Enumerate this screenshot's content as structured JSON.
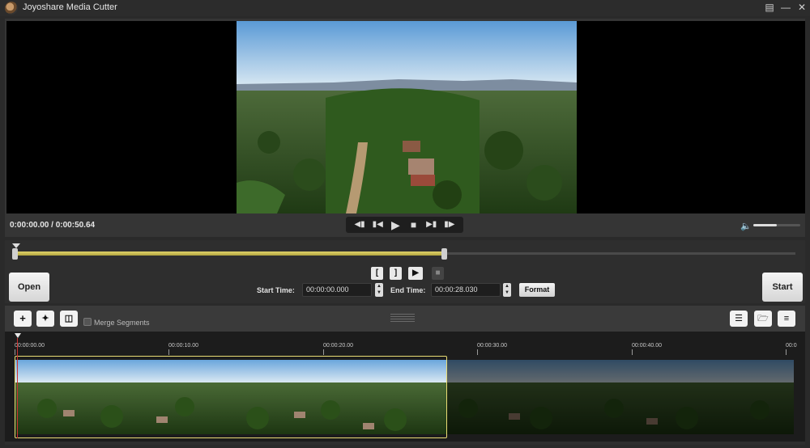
{
  "app": {
    "title": "Joyoshare Media Cutter"
  },
  "player": {
    "current_time": "0:00:00.00",
    "total_time": "0:00:50.64",
    "volume": 0.5
  },
  "edit": {
    "open_label": "Open",
    "start_label": "Start",
    "start_time_label": "Start Time:",
    "start_time_value": "00:00:00.000",
    "end_time_label": "End Time:",
    "end_time_value": "00:00:28.030",
    "format_label": "Format",
    "range_start_fraction": 0.0,
    "range_end_fraction": 0.55
  },
  "timeline": {
    "merge_label": "Merge Segments",
    "ticks": [
      "00:00:00.00",
      "00:00:10.00",
      "00:00:20.00",
      "00:00:30.00",
      "00:00:40.00",
      "00:0"
    ]
  },
  "colors": {
    "accent": "#e9dc74",
    "background": "#2a2a2a",
    "panel": "#2e2e2e"
  }
}
